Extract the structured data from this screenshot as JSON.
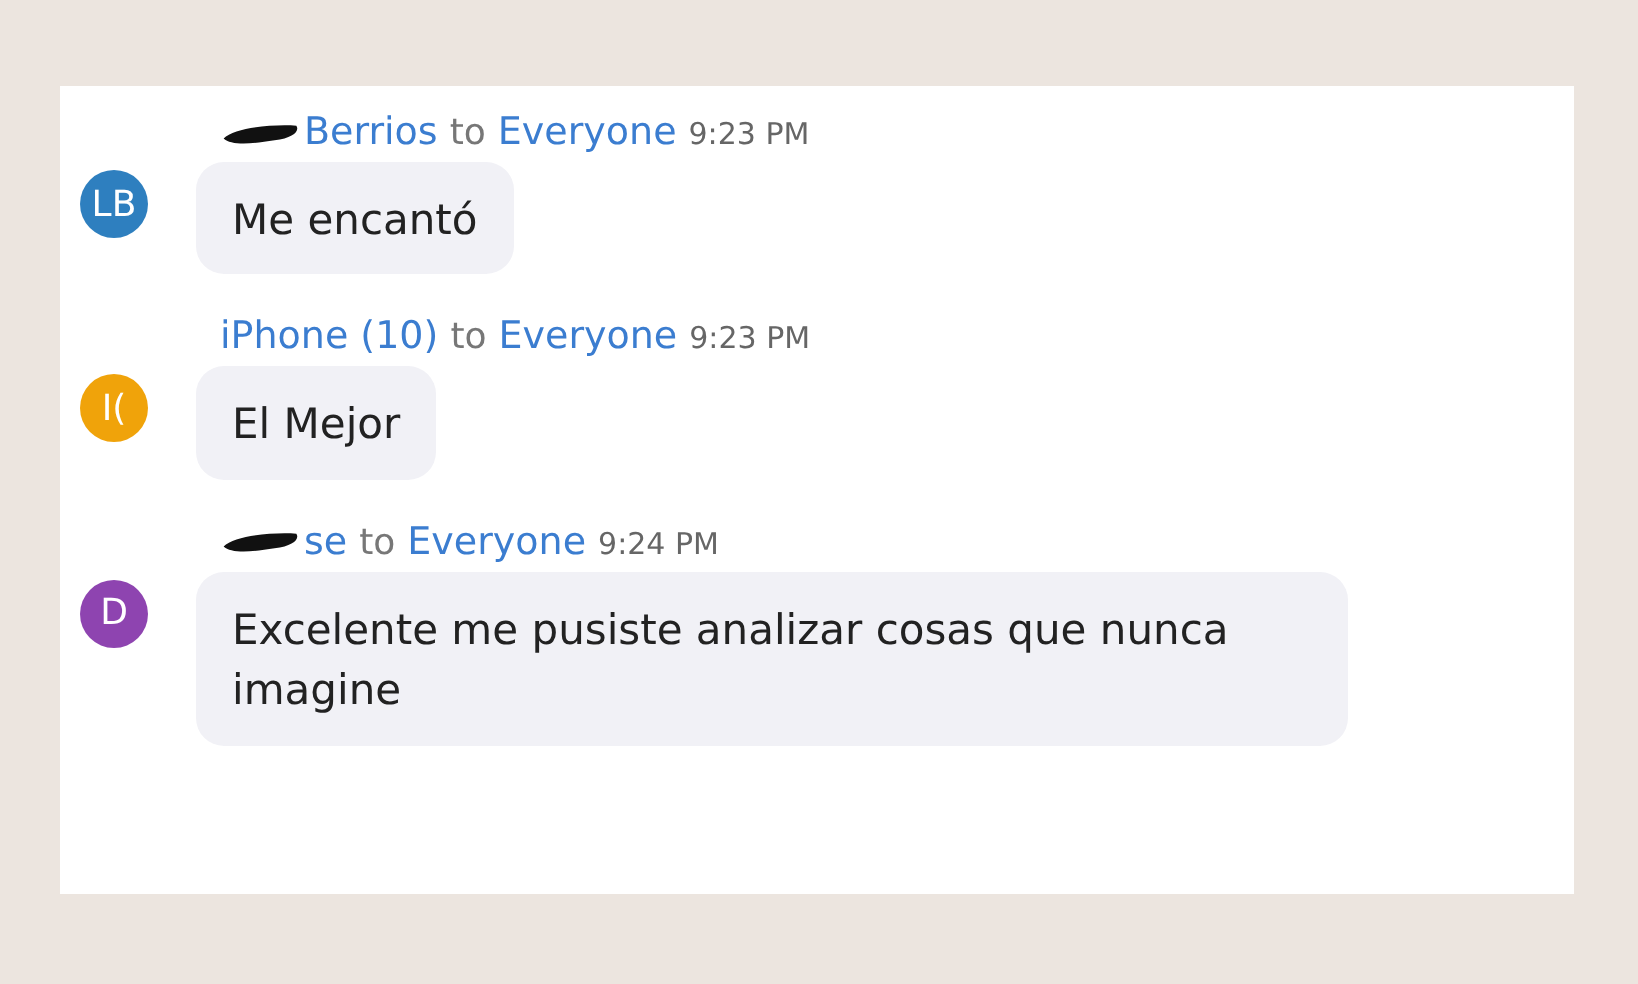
{
  "messages": [
    {
      "sender": "Berrios",
      "redacted": true,
      "to_word": "to",
      "recipient": "Everyone",
      "time": "9:23 PM",
      "avatar": {
        "initials": "LB",
        "color": "#2e7fbf"
      },
      "text": "Me encantó"
    },
    {
      "sender": "iPhone (10)",
      "redacted": false,
      "to_word": "to",
      "recipient": "Everyone",
      "time": "9:23 PM",
      "avatar": {
        "initials": "I(",
        "color": "#f0a30a"
      },
      "text": "El Mejor"
    },
    {
      "sender": "se",
      "redacted": true,
      "to_word": "to",
      "recipient": "Everyone",
      "time": "9:24 PM",
      "avatar": {
        "initials": "D",
        "color": "#8e44b0"
      },
      "text": "Excelente me pusiste analizar cosas que nunca imagine"
    }
  ]
}
